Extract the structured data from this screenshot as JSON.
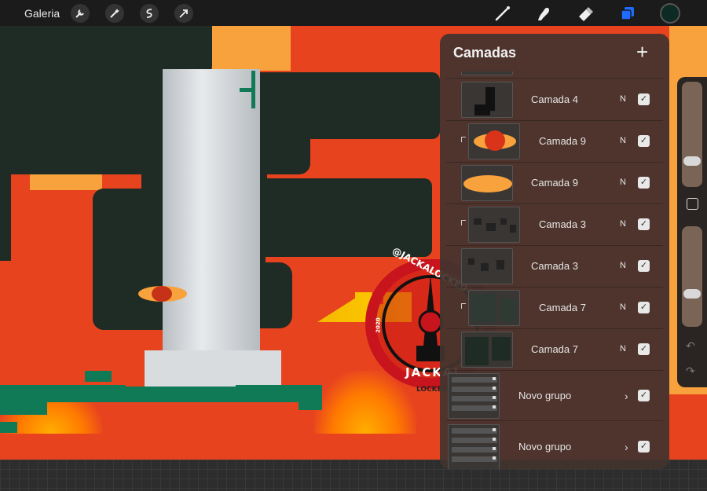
{
  "topbar": {
    "gallery_label": "Galeria",
    "actions": [
      "wrench-icon",
      "magic-wand-icon",
      "selection-icon",
      "transform-arrow-icon"
    ],
    "tools": [
      "brush-icon",
      "smudge-icon",
      "eraser-icon",
      "layers-icon"
    ],
    "active_tool": "layers-icon",
    "current_color": "#0e2a24"
  },
  "layers_panel": {
    "title": "Camadas",
    "add_label": "+",
    "layers": [
      {
        "name": "Camada 4",
        "blend": "N",
        "visible": true,
        "clipped": false
      },
      {
        "name": "Camada 9",
        "blend": "N",
        "visible": true,
        "clipped": true
      },
      {
        "name": "Camada 9",
        "blend": "N",
        "visible": true,
        "clipped": false
      },
      {
        "name": "Camada 3",
        "blend": "N",
        "visible": true,
        "clipped": true
      },
      {
        "name": "Camada 3",
        "blend": "N",
        "visible": true,
        "clipped": false
      },
      {
        "name": "Camada 7",
        "blend": "N",
        "visible": true,
        "clipped": true
      },
      {
        "name": "Camada 7",
        "blend": "N",
        "visible": true,
        "clipped": false
      }
    ],
    "groups": [
      {
        "name": "Novo grupo",
        "visible": true,
        "expanded": false
      },
      {
        "name": "Novo grupo",
        "visible": true,
        "expanded": false
      }
    ],
    "check_mark": "✓",
    "chevron": "›"
  },
  "sidebar": {
    "brush_size": 0.2,
    "opacity": 0.3,
    "undo_icon": "↶",
    "redo_icon": "↷"
  },
  "watermark": {
    "handle": "@JACKALOCKED",
    "name": "JACKAL",
    "sub": "LOCKED",
    "year": "2020"
  },
  "colors": {
    "canvas_red": "#e8431f",
    "canvas_orange": "#f7a23c",
    "canvas_dark": "#1f2b25",
    "canvas_green": "#0f7a55",
    "active_blue": "#1f6bff"
  }
}
